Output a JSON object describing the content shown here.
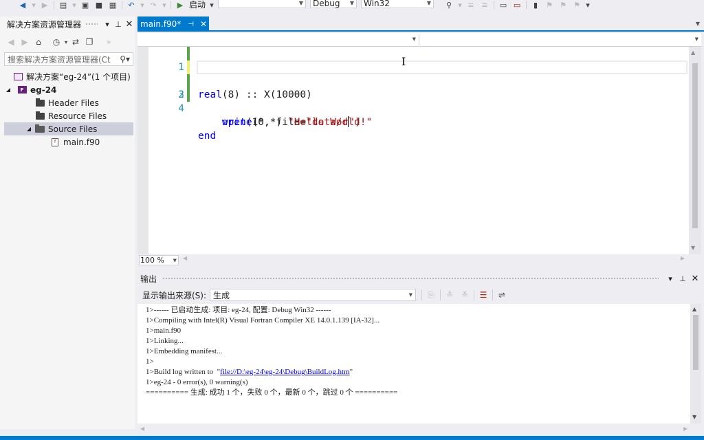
{
  "toolbar": {
    "start_label": "启动",
    "config_value": "Debug",
    "platform_value": "Win32",
    "combo_empty": ""
  },
  "solution_explorer": {
    "title": "解决方案资源管理器",
    "search_placeholder": "搜索解决方案资源管理器(Ct",
    "tree": {
      "solution": "解决方案“eg-24”(1 个项目)",
      "project": "eg-24",
      "project_badge": "F",
      "header_files": "Header Files",
      "resource_files": "Resource Files",
      "source_files": "Source Files",
      "main_file": "main.f90"
    }
  },
  "editor": {
    "tab_label": "main.f90*",
    "lines": [
      {
        "num": "1",
        "text": "real(8) :: X(10000)"
      },
      {
        "num": "2",
        "text": "open(10, file=\"data/d\")"
      },
      {
        "num": "3",
        "text": "write(*,*) \"Hello World!\""
      },
      {
        "num": "4",
        "text": "end"
      }
    ],
    "zoom": "100 %"
  },
  "output": {
    "title": "输出",
    "source_label": "显示输出来源(S):",
    "source_value": "生成",
    "lines": [
      "1>------ 已启动生成: 项目: eg-24, 配置: Debug Win32 ------",
      "1>Compiling with Intel(R) Visual Fortran Compiler XE 14.0.1.139 [IA-32]...",
      "1>main.f90",
      "1>Linking...",
      "1>Embedding manifest...",
      "1>",
      "1>eg-24 - 0 error(s), 0 warning(s)",
      "========== 生成: 成功 1 个，失败 0 个，最新 0 个，跳过 0 个 =========="
    ],
    "buildlog_prefix": "1>Build log written to  \"",
    "buildlog_link": "file://D:\\eg-24\\eg-24\\Debug\\BuildLog.htm",
    "buildlog_suffix": "\""
  },
  "colors": {
    "accent": "#007acc",
    "keyword": "#0000ff",
    "string": "#a31515",
    "line_number": "#2b91af",
    "changed_saved": "#57a64a",
    "changed_unsaved": "#efef77"
  }
}
